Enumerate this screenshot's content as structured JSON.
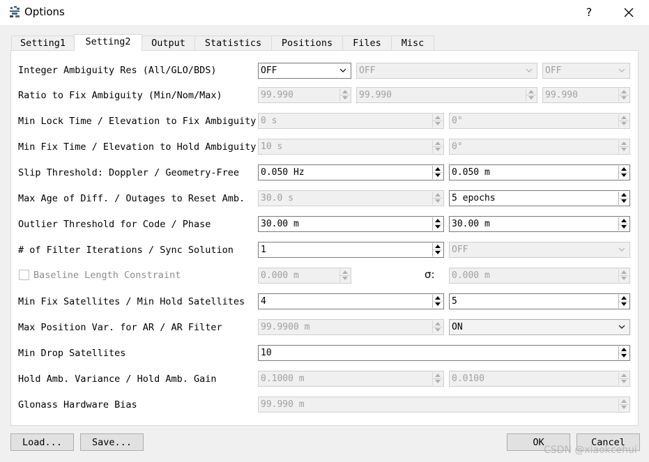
{
  "window": {
    "title": "Options",
    "help_label": "?"
  },
  "tabs": [
    {
      "label": "Setting1"
    },
    {
      "label": "Setting2",
      "active": true
    },
    {
      "label": "Output"
    },
    {
      "label": "Statistics"
    },
    {
      "label": "Positions"
    },
    {
      "label": "Files"
    },
    {
      "label": "Misc"
    }
  ],
  "rows": {
    "ambiguity_res": {
      "label": "Integer Ambiguity Res (All/GLO/BDS)",
      "all": "OFF",
      "glo": "OFF",
      "bds": "OFF"
    },
    "ratio_fix": {
      "label": "Ratio to Fix Ambiguity (Min/Nom/Max)",
      "min": "99.990",
      "nom": "99.990",
      "max": "99.990"
    },
    "min_lock": {
      "label": "Min Lock Time / Elevation to Fix Ambiguity",
      "time": "0 s",
      "elev": "0°"
    },
    "min_fix": {
      "label": "Min Fix Time / Elevation to Hold Ambiguity",
      "time": "10 s",
      "elev": "0°"
    },
    "slip": {
      "label": "Slip Threshold: Doppler / Geometry-Free",
      "doppler": "0.050 Hz",
      "gf": "0.050 m"
    },
    "max_age": {
      "label": "Max Age of Diff. / Outages to Reset Amb.",
      "age": "30.0 s",
      "outages": "5 epochs"
    },
    "outlier": {
      "label": "Outlier Threshold for Code / Phase",
      "code": "30.00 m",
      "phase": "30.00 m"
    },
    "filter_iter": {
      "label": "# of Filter Iterations / Sync Solution",
      "iter": "1",
      "sync": "OFF"
    },
    "baseline": {
      "label": "Baseline Length Constraint",
      "length": "0.000 m",
      "sigma_label": "σ:",
      "sigma": "0.000 m"
    },
    "min_fix_sats": {
      "label": "Min Fix Satellites / Min Hold Satellites",
      "fix": "4",
      "hold": "5"
    },
    "max_pos_var": {
      "label": "Max Position Var. for AR / AR Filter",
      "var": "99.9900 m",
      "filter": "ON"
    },
    "min_drop": {
      "label": "Min Drop Satellites",
      "value": "10"
    },
    "hold_amb": {
      "label": "Hold Amb. Variance / Hold Amb. Gain",
      "variance": "0.1000 m",
      "gain": "0.0100"
    },
    "glonass_bias": {
      "label": "Glonass Hardware Bias",
      "value": "99.990 m"
    }
  },
  "buttons": {
    "load": "Load...",
    "save": "Save...",
    "ok": "OK",
    "cancel": "Cancel"
  },
  "watermark": "CSDN @xiaokcehui"
}
